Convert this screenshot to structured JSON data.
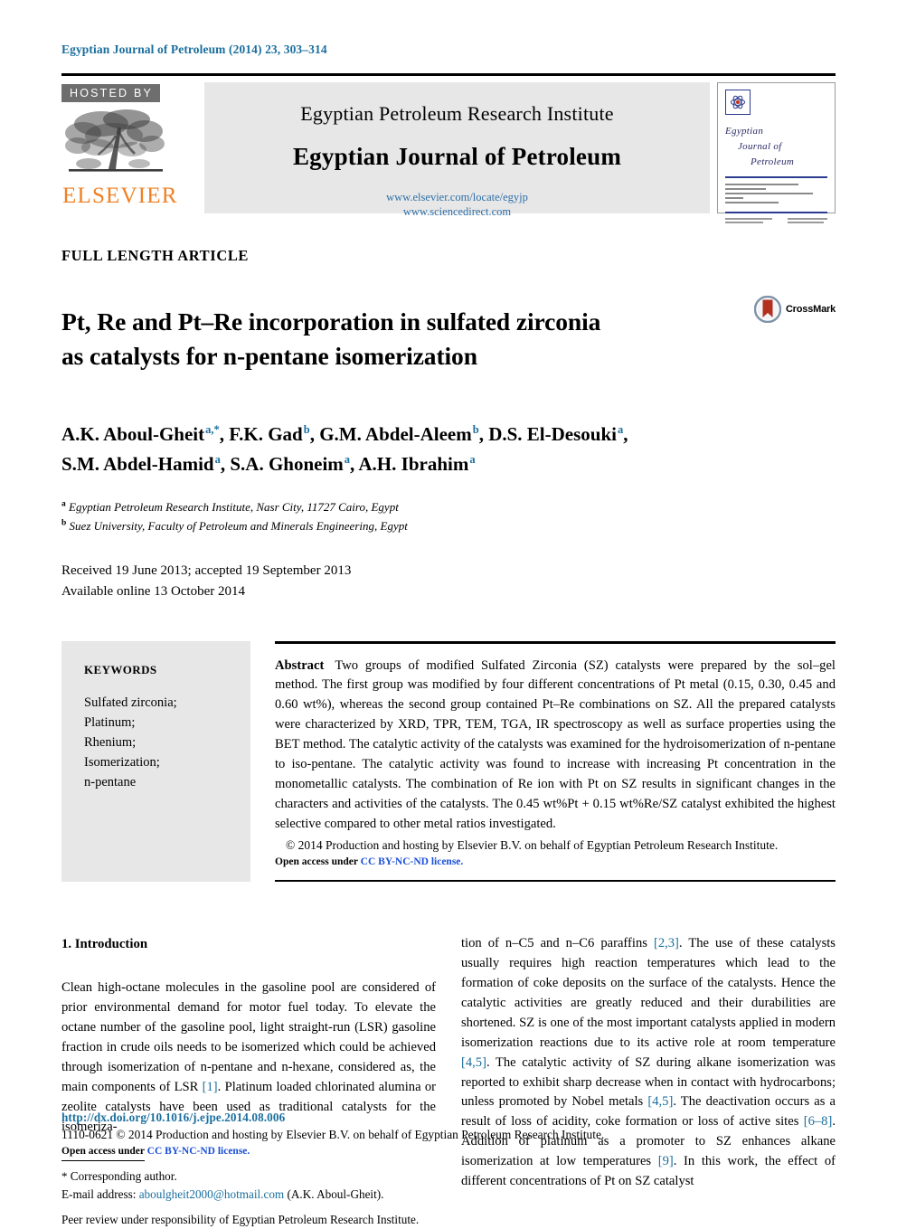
{
  "running_head": "Egyptian Journal of Petroleum (2014) 23, 303–314",
  "masthead": {
    "hosted_by": "HOSTED BY",
    "publisher_name": "ELSEVIER",
    "institute": "Egyptian Petroleum Research Institute",
    "journal": "Egyptian Journal of Petroleum",
    "link1": "www.elsevier.com/locate/egyjp",
    "link2": "www.sciencedirect.com",
    "cover": {
      "line1": "Egyptian",
      "line2": "Journal of",
      "line3": "Petroleum"
    }
  },
  "article": {
    "type": "FULL LENGTH ARTICLE",
    "title_line1": "Pt, Re and Pt–Re incorporation in sulfated zirconia",
    "title_line2": "as catalysts for n-pentane isomerization",
    "crossmark_label": "CrossMark"
  },
  "authors": {
    "line1": [
      {
        "name": "A.K. Aboul-Gheit",
        "sup": "a,*"
      },
      {
        "name": "F.K. Gad",
        "sup": "b"
      },
      {
        "name": "G.M. Abdel-Aleem",
        "sup": "b"
      },
      {
        "name": "D.S. El-Desouki",
        "sup": "a"
      }
    ],
    "line2": [
      {
        "name": "S.M. Abdel-Hamid",
        "sup": "a"
      },
      {
        "name": "S.A. Ghoneim",
        "sup": "a"
      },
      {
        "name": "A.H. Ibrahim",
        "sup": "a"
      }
    ]
  },
  "affiliations": [
    {
      "marker": "a",
      "text": "Egyptian Petroleum Research Institute, Nasr City, 11727 Cairo, Egypt"
    },
    {
      "marker": "b",
      "text": "Suez University, Faculty of Petroleum and Minerals Engineering, Egypt"
    }
  ],
  "dates": {
    "received": "Received 19 June 2013; accepted 19 September 2013",
    "available": "Available online 13 October 2014"
  },
  "keywords": {
    "heading": "KEYWORDS",
    "items": "Sulfated zirconia;\nPlatinum;\nRhenium;\nIsomerization;\nn-pentane"
  },
  "abstract": {
    "label": "Abstract",
    "text": "Two groups of modified Sulfated Zirconia (SZ) catalysts were prepared by the sol–gel method. The first group was modified by four different concentrations of Pt metal (0.15, 0.30, 0.45 and 0.60 wt%), whereas the second group contained Pt–Re combinations on SZ. All the prepared catalysts were characterized by XRD, TPR, TEM, TGA, IR spectroscopy as well as surface properties using the BET method. The catalytic activity of the catalysts was examined for the hydroisomerization of n-pentane to iso-pentane. The catalytic activity was found to increase with increasing Pt concentration in the monometallic catalysts. The combination of Re ion with Pt on SZ results in significant changes in the characters and activities of the catalysts. The 0.45 wt%Pt + 0.15 wt%Re/SZ catalyst exhibited the highest selective compared to other metal ratios investigated.",
    "copyright": "© 2014 Production and hosting by Elsevier B.V. on behalf of Egyptian Petroleum Research Institute.",
    "open_access_prefix": "Open access under ",
    "license": "CC BY-NC-ND license."
  },
  "body": {
    "section_heading": "1. Introduction",
    "left_paragraph_part1": "Clean high-octane molecules in the gasoline pool are considered of prior environmental demand for motor fuel today. To elevate the octane number of the gasoline pool, light straight-run (LSR) gasoline fraction in crude oils needs to be isomerized which could be achieved through isomerization of n-pentane and n-hexane, considered as, the main components of LSR ",
    "cite_1": "[1]",
    "left_paragraph_part2": ". Platinum loaded chlorinated alumina or zeolite catalysts have been used as traditional catalysts for the isomeriza-",
    "right_part1": "tion of n–C5 and n–C6 paraffins ",
    "cite_23": "[2,3]",
    "right_part2": ". The use of these catalysts usually requires high reaction temperatures which lead to the formation of coke deposits on the surface of the catalysts. Hence the catalytic activities are greatly reduced and their durabilities are shortened. SZ is one of the most important catalysts applied in modern isomerization reactions due to its active role at room temperature ",
    "cite_45a": "[4,5]",
    "right_part3": ". The catalytic activity of SZ during alkane isomerization was reported to exhibit sharp decrease when in contact with hydrocarbons; unless promoted by Nobel metals ",
    "cite_45b": "[4,5]",
    "right_part4": ". The deactivation occurs as a result of loss of acidity, coke formation or loss of active sites ",
    "cite_68": "[6–8]",
    "right_part5": ". Addition of platinum as a promoter to SZ enhances alkane isomerization at low temperatures ",
    "cite_9": "[9]",
    "right_part6": ". In this work, the effect of different concentrations of Pt on SZ catalyst"
  },
  "footnotes": {
    "corresponding": "Corresponding author.",
    "email_label": "E-mail address:",
    "email": "aboulgheit2000@hotmail.com",
    "email_suffix": "(A.K. Aboul-Gheit).",
    "peer_review": "Peer review under responsibility of Egyptian Petroleum Research Institute."
  },
  "page_footer": {
    "doi": "http://dx.doi.org/10.1016/j.ejpe.2014.08.006",
    "issn_line": "1110-0621 © 2014 Production and hosting by Elsevier B.V. on behalf of Egyptian Petroleum Research Institute.",
    "open_access_prefix": "Open access under ",
    "license": "CC BY-NC-ND license."
  },
  "colors": {
    "link_blue": "#1a6f9e",
    "license_blue": "#1a4fd6",
    "elsevier_orange": "#F08022",
    "hosted_gray": "#6e6e6e",
    "panel_gray": "#e7e7e7"
  }
}
